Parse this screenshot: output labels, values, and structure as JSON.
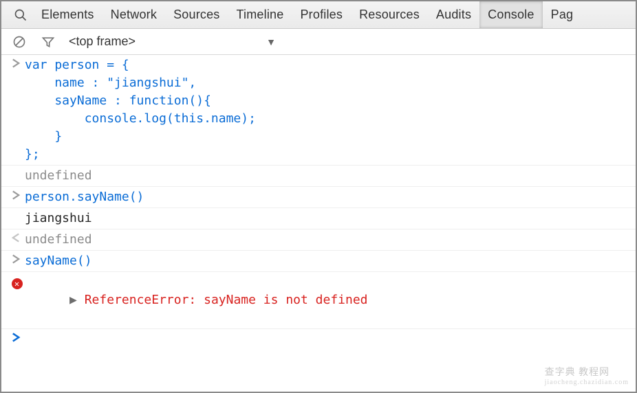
{
  "tabs": {
    "items": [
      "Elements",
      "Network",
      "Sources",
      "Timeline",
      "Profiles",
      "Resources",
      "Audits",
      "Console",
      "Pag"
    ],
    "active_index": 7
  },
  "toolbar": {
    "frame_selector": "<top frame>"
  },
  "console_rows": [
    {
      "kind": "input",
      "text": "var person = {\n    name : \"jiangshui\",\n    sayName : function(){\n        console.log(this.name);\n    }\n};"
    },
    {
      "kind": "result_undef",
      "text": "undefined"
    },
    {
      "kind": "input",
      "text": "person.sayName()"
    },
    {
      "kind": "log",
      "text": "jiangshui"
    },
    {
      "kind": "result_undef",
      "text": "undefined"
    },
    {
      "kind": "input",
      "text": "sayName()"
    },
    {
      "kind": "error",
      "text": "ReferenceError: sayName is not defined"
    },
    {
      "kind": "prompt",
      "text": ""
    }
  ],
  "watermark": {
    "main": "查字典  教程网",
    "sub": "jiaocheng.chazidian.com"
  }
}
